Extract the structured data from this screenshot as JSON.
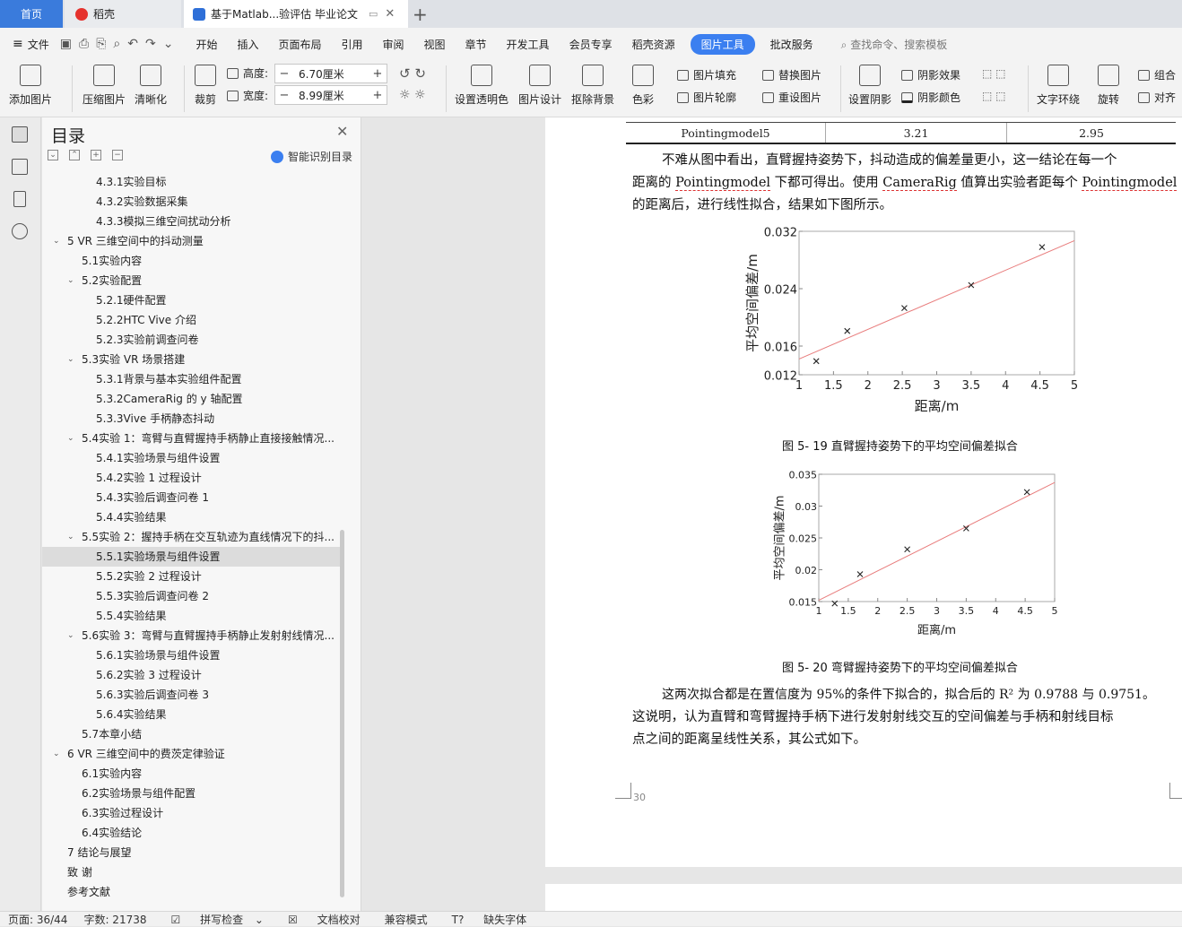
{
  "tabs": {
    "home": "首页",
    "docer": "稻壳",
    "doc": "基于Matlab...验评估 毕业论文"
  },
  "menu": {
    "file": "文件",
    "items": [
      "开始",
      "插入",
      "页面布局",
      "引用",
      "审阅",
      "视图",
      "章节",
      "开发工具",
      "会员专享",
      "稻壳资源"
    ],
    "picture_tools": "图片工具",
    "review_service": "批改服务",
    "search": "查找命令、搜索模板"
  },
  "ribbon": {
    "add_picture": "添加图片",
    "compress": "压缩图片",
    "sharpen": "清晰化",
    "crop": "裁剪",
    "height_label": "高度:",
    "height_value": "6.70厘米",
    "width_label": "宽度:",
    "width_value": "8.99厘米",
    "set_transparent": "设置透明色",
    "picture_design": "图片设计",
    "remove_bg": "抠除背景",
    "color": "色彩",
    "picture_fill": "图片填充",
    "picture_outline": "图片轮廓",
    "replace_picture": "替换图片",
    "reset_picture": "重设图片",
    "set_shadow": "设置阴影",
    "shadow_effect": "阴影效果",
    "shadow_color": "阴影颜色",
    "text_wrap": "文字环绕",
    "rotate": "旋转",
    "group": "组合",
    "align": "对齐"
  },
  "toc": {
    "title": "目录",
    "smart": "智能识别目录",
    "items": [
      {
        "text": "4.3.1实验目标",
        "level": 3
      },
      {
        "text": "4.3.2实验数据采集",
        "level": 3
      },
      {
        "text": "4.3.3模拟三维空间扰动分析",
        "level": 3
      },
      {
        "text": "5    VR 三维空间中的抖动测量",
        "level": 1,
        "arrow": true
      },
      {
        "text": "5.1实验内容",
        "level": 2
      },
      {
        "text": "5.2实验配置",
        "level": 2,
        "arrow": true
      },
      {
        "text": "5.2.1硬件配置",
        "level": 3
      },
      {
        "text": "5.2.2HTC Vive 介绍",
        "level": 3
      },
      {
        "text": "5.2.3实验前调查问卷",
        "level": 3
      },
      {
        "text": "5.3实验 VR 场景搭建",
        "level": 2,
        "arrow": true
      },
      {
        "text": "5.3.1背景与基本实验组件配置",
        "level": 3
      },
      {
        "text": "5.3.2CameraRig 的 y 轴配置",
        "level": 3
      },
      {
        "text": "5.3.3Vive 手柄静态抖动",
        "level": 3
      },
      {
        "text": "5.4实验 1：弯臂与直臂握持手柄静止直接接触情况...",
        "level": 2,
        "arrow": true
      },
      {
        "text": "5.4.1实验场景与组件设置",
        "level": 3
      },
      {
        "text": "5.4.2实验 1 过程设计",
        "level": 3
      },
      {
        "text": "5.4.3实验后调查问卷 1",
        "level": 3
      },
      {
        "text": "5.4.4实验结果",
        "level": 3
      },
      {
        "text": "5.5实验 2：握持手柄在交互轨迹为直线情况下的抖...",
        "level": 2,
        "arrow": true
      },
      {
        "text": "5.5.1实验场景与组件设置",
        "level": 3,
        "selected": true
      },
      {
        "text": "5.5.2实验 2 过程设计",
        "level": 3
      },
      {
        "text": "5.5.3实验后调查问卷 2",
        "level": 3
      },
      {
        "text": "5.5.4实验结果",
        "level": 3
      },
      {
        "text": "5.6实验 3：弯臂与直臂握持手柄静止发射射线情况...",
        "level": 2,
        "arrow": true
      },
      {
        "text": "5.6.1实验场景与组件设置",
        "level": 3
      },
      {
        "text": "5.6.2实验 3 过程设计",
        "level": 3
      },
      {
        "text": "5.6.3实验后调查问卷 3",
        "level": 3
      },
      {
        "text": "5.6.4实验结果",
        "level": 3
      },
      {
        "text": "5.7本章小结",
        "level": 2
      },
      {
        "text": "6    VR 三维空间中的费茨定律验证",
        "level": 1,
        "arrow": true
      },
      {
        "text": "6.1实验内容",
        "level": 2
      },
      {
        "text": "6.2实验场景与组件配置",
        "level": 2
      },
      {
        "text": "6.3实验过程设计",
        "level": 2
      },
      {
        "text": "6.4实验结论",
        "level": 2
      },
      {
        "text": "7    结论与展望",
        "level": 1
      },
      {
        "text": "致    谢",
        "level": 1
      },
      {
        "text": "参考文献",
        "level": 1
      }
    ]
  },
  "document": {
    "table_last_row": {
      "model": "Pointingmodel5",
      "v1": "3.21",
      "v2": "2.95"
    },
    "para1_a": "不难从图中看出，直臂握持姿势下，抖动造成的偏差量更小，这一结论在每一个",
    "para1_b1": "距离的 ",
    "para1_b_link1": "Pointingmodel",
    "para1_b2": " 下都可得出。使用 ",
    "para1_b_link2": "CameraRig",
    "para1_b3": " 值算出实验者距每个 ",
    "para1_b_link3": "Pointingmodel",
    "para1_c": "的距离后，进行线性拟合，结果如下图所示。",
    "caption1": "图 5- 19   直臂握持姿势下的平均空间偏差拟合",
    "caption2": "图 5- 20   弯臂握持姿势下的平均空间偏差拟合",
    "para2_a": "这两次拟合都是在置信度为 95%的条件下拟合的，拟合后的 R² 为 0.9788 与 0.9751。",
    "para2_b": "这说明，认为直臂和弯臂握持手柄下进行发射射线交互的空间偏差与手柄和射线目标",
    "para2_c": "点之间的距离呈线性关系，其公式如下。",
    "page_number": "30"
  },
  "chart_data": [
    {
      "type": "scatter",
      "title": "",
      "xlabel": "距离/m",
      "ylabel": "平均空间偏差/m",
      "xlim": [
        1,
        5
      ],
      "ylim": [
        0.012,
        0.032
      ],
      "xticks": [
        "1",
        "1.5",
        "2",
        "2.5",
        "3",
        "3.5",
        "4",
        "4.5",
        "5"
      ],
      "yticks": [
        "0.012",
        "0.016",
        "0.024",
        "0.032"
      ],
      "ytick_values": [
        0.012,
        0.016,
        0.024,
        0.032
      ],
      "marker": "x",
      "points": [
        [
          1.25,
          0.0139
        ],
        [
          1.7,
          0.0181
        ],
        [
          2.53,
          0.0213
        ],
        [
          3.5,
          0.0245
        ],
        [
          4.53,
          0.0298
        ]
      ],
      "fit_line": [
        [
          1,
          0.0142
        ],
        [
          5,
          0.0307
        ]
      ],
      "fit_color": "#e87c7c"
    },
    {
      "type": "scatter",
      "title": "",
      "xlabel": "距离/m",
      "ylabel": "平均空间偏差/m",
      "xlim": [
        1,
        5
      ],
      "ylim": [
        0.015,
        0.035
      ],
      "xticks": [
        "1",
        "1.5",
        "2",
        "2.5",
        "3",
        "3.5",
        "4",
        "4.5",
        "5"
      ],
      "yticks": [
        "0.015",
        "0.02",
        "0.025",
        "0.03",
        "0.035"
      ],
      "ytick_values": [
        0.015,
        0.02,
        0.025,
        0.03,
        0.035
      ],
      "marker": "x",
      "points": [
        [
          1.27,
          0.0147
        ],
        [
          1.7,
          0.0193
        ],
        [
          2.5,
          0.0232
        ],
        [
          3.5,
          0.0265
        ],
        [
          4.53,
          0.0322
        ]
      ],
      "fit_line": [
        [
          1,
          0.0152
        ],
        [
          5,
          0.0337
        ]
      ],
      "fit_color": "#e87c7c"
    }
  ],
  "status": {
    "page": "页面: 36/44",
    "words": "字数: 21738",
    "spell": "拼写检查",
    "proof": "文档校对",
    "compat": "兼容模式",
    "missing_font": "缺失字体"
  },
  "colors": {
    "accent": "#3b7ff0",
    "home_tab": "#3a7bdc"
  }
}
